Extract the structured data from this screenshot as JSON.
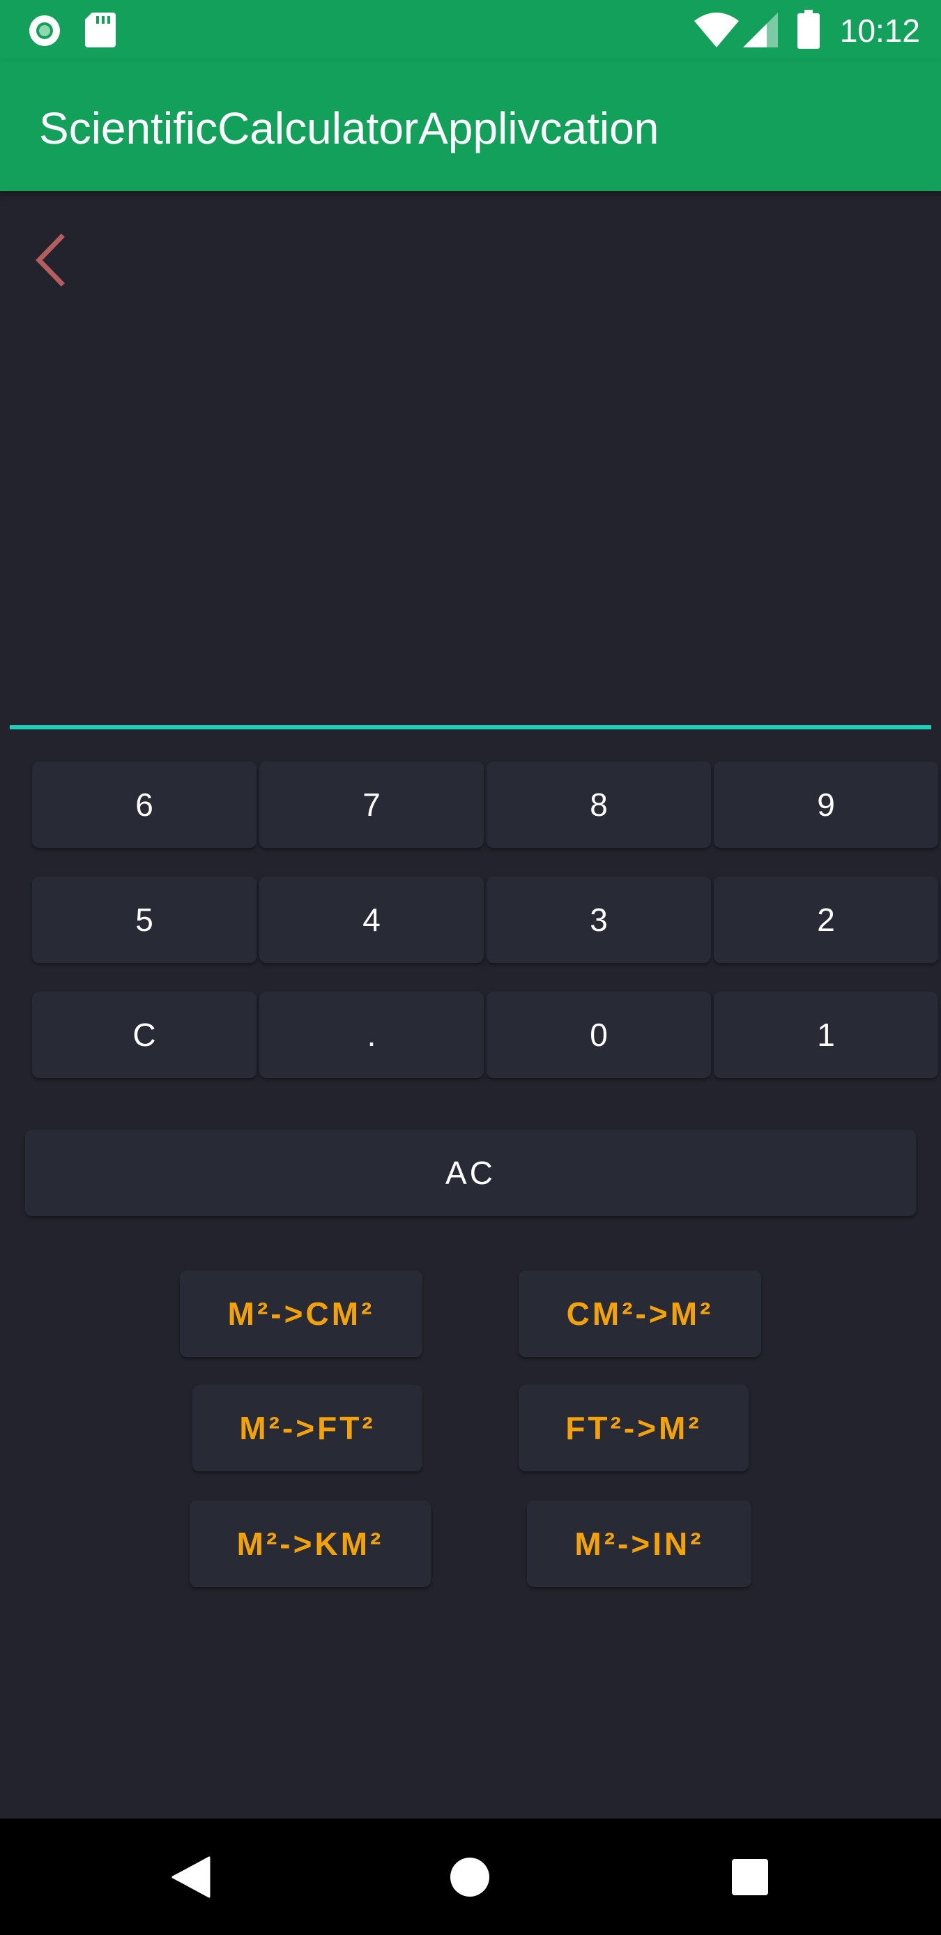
{
  "status_bar": {
    "time": "10:12",
    "icons": [
      "notification-dot-icon",
      "sd-card-icon",
      "wifi-icon",
      "cell-signal-icon",
      "battery-icon"
    ]
  },
  "app_bar": {
    "title": "ScientificCalculatorApplivcation",
    "color": "#12a05a"
  },
  "display": {
    "back_icon": "chevron-left-icon",
    "value": "",
    "underline_color": "#1fcfb8"
  },
  "keypad": {
    "rows": [
      [
        "6",
        "7",
        "8",
        "9"
      ],
      [
        "5",
        "4",
        "3",
        "2"
      ],
      [
        "C",
        ".",
        "0",
        "1"
      ]
    ],
    "ac_label": "AC"
  },
  "conversions": {
    "m2_to_cm2": "M²->CM²",
    "cm2_to_m2": "CM²->M²",
    "m2_to_ft2": "M²->FT²",
    "ft2_to_m2": "FT²->M²",
    "m2_to_km2": "M²->KM²",
    "m2_to_in2": "M²->IN²",
    "accent_color": "#f4a20a"
  },
  "nav_bar": {
    "icons": [
      "back-triangle-icon",
      "home-circle-icon",
      "recents-square-icon"
    ]
  }
}
